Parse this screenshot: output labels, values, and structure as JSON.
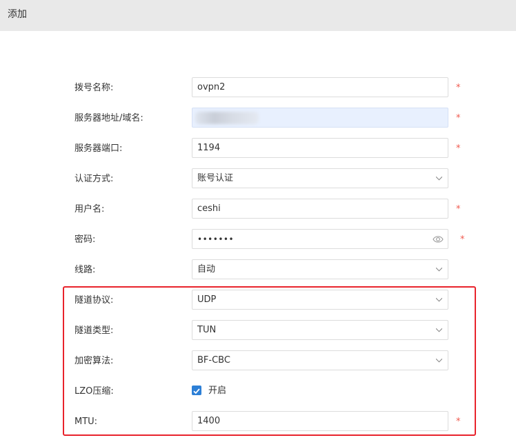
{
  "header": {
    "title": "添加"
  },
  "form": {
    "dial_name": {
      "label": "拨号名称:",
      "value": "ovpn2",
      "required": "*"
    },
    "server_address": {
      "label": "服务器地址/域名:",
      "value": "",
      "required": "*"
    },
    "server_port": {
      "label": "服务器端口:",
      "value": "1194",
      "required": "*"
    },
    "auth_method": {
      "label": "认证方式:",
      "value": "账号认证"
    },
    "username": {
      "label": "用户名:",
      "value": "ceshi",
      "required": "*"
    },
    "password": {
      "label": "密码:",
      "value": "•••••••",
      "required": "*"
    },
    "line": {
      "label": "线路:",
      "value": "自动"
    },
    "tunnel_protocol": {
      "label": "隧道协议:",
      "value": "UDP"
    },
    "tunnel_type": {
      "label": "隧道类型:",
      "value": "TUN"
    },
    "cipher": {
      "label": "加密算法:",
      "value": "BF-CBC"
    },
    "lzo": {
      "label": "LZO压缩:",
      "checked": true,
      "option_label": "开启"
    },
    "mtu": {
      "label": "MTU:",
      "value": "1400",
      "required": "*"
    }
  },
  "colors": {
    "header_bg": "#e9e9e9",
    "required": "#f05a4f",
    "checkbox": "#2d7fd6",
    "highlight_box": "#e8222b",
    "autofill_bg": "#e8f0fe"
  },
  "icons": {
    "select": "chevron-down-icon",
    "password_toggle": "eye-icon",
    "checkbox": "checkmark-icon"
  }
}
